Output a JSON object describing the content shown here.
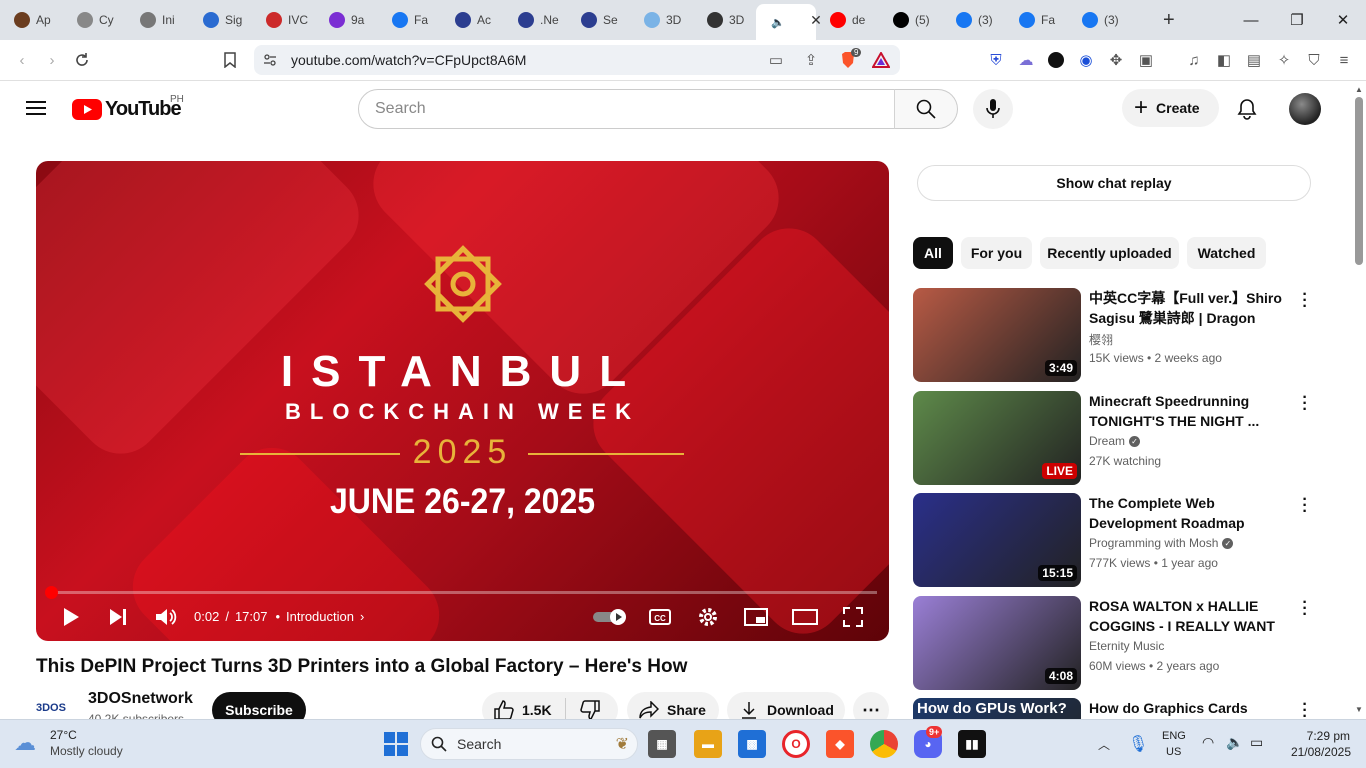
{
  "browser": {
    "tabs": [
      {
        "label": "Ap",
        "color": "#6b3d1f"
      },
      {
        "label": "Cy",
        "color": "#888888"
      },
      {
        "label": "Ini",
        "color": "#777777"
      },
      {
        "label": "Sig",
        "color": "#2a6bd1"
      },
      {
        "label": "IVC",
        "color": "#cc2a2a"
      },
      {
        "label": "9a",
        "color": "#7b2ed3"
      },
      {
        "label": "Fa",
        "color": "#1877f2"
      },
      {
        "label": "Ac",
        "color": "#2c3e90"
      },
      {
        "label": ".Ne",
        "color": "#2c3e90"
      },
      {
        "label": "Se",
        "color": "#2c3e90"
      },
      {
        "label": "3D",
        "color": "#7ab3e6"
      },
      {
        "label": "3D",
        "color": "#333333"
      },
      {
        "label": "",
        "color": "#ffffff"
      },
      {
        "label": "de",
        "color": "#ff0000"
      },
      {
        "label": "(5)",
        "color": "#000000"
      },
      {
        "label": "(3)",
        "color": "#1877f2"
      },
      {
        "label": "Fa",
        "color": "#1877f2"
      },
      {
        "label": "(3)",
        "color": "#1877f2"
      }
    ],
    "url": "youtube.com/watch?v=CFpUpct8A6M",
    "brave_badge": "9"
  },
  "youtube": {
    "logo_text": "YouTube",
    "region": "PH",
    "search_placeholder": "Search",
    "create_label": "Create"
  },
  "video": {
    "time_current": "0:02",
    "time_separator": "/",
    "time_total": "17:07",
    "chapter": "Introduction",
    "progress_fraction": 0.005,
    "title": "This DePIN Project Turns 3D Printers into a Global Factory – Here's How",
    "overlay": {
      "line1": "ISTANBUL",
      "line2": "BLOCKCHAIN WEEK",
      "year": "2025",
      "dates": "JUNE 26-27, 2025"
    },
    "channel": {
      "logo_text": "3DOS",
      "name": "3DOSnetwork",
      "subscribers": "40.2K subscribers"
    },
    "subscribe_label": "Subscribe",
    "likes": "1.5K",
    "share_label": "Share",
    "download_label": "Download"
  },
  "sidebar": {
    "chat_replay": "Show chat replay",
    "chips": [
      "All",
      "For you",
      "Recently uploaded",
      "Watched"
    ],
    "recommendations": [
      {
        "title": "中英CC字幕【Full ver.】Shiro Sagisu 鷺巣詩郎 | Dragon Raja...",
        "channel": "樱翎",
        "verified": false,
        "meta": "15K views • 2 weeks ago",
        "badge": "3:49",
        "live": false,
        "thumb_color": "#b85a45"
      },
      {
        "title": "Minecraft Speedrunning TONIGHT'S THE NIGHT ...",
        "channel": "Dream",
        "verified": true,
        "meta": "27K watching",
        "badge": "LIVE",
        "live": true,
        "thumb_color": "#5e8a4a"
      },
      {
        "title": "The Complete Web Development Roadmap",
        "channel": "Programming with Mosh",
        "verified": true,
        "meta": "777K views • 1 year ago",
        "badge": "15:15",
        "live": false,
        "thumb_color": "#2a2f8a"
      },
      {
        "title": "ROSA WALTON x HALLIE COGGINS - I REALLY WANT TO...",
        "channel": "Eternity Music",
        "verified": false,
        "meta": "60M views • 2 years ago",
        "badge": "4:08",
        "live": false,
        "thumb_color": "#9a7fd6"
      },
      {
        "title": "How do Graphics Cards Work?",
        "channel": "",
        "verified": false,
        "meta": "",
        "badge": "",
        "live": false,
        "thumb_color": "#1d3a6b",
        "thumb_text": "How do GPUs Work?"
      }
    ]
  },
  "taskbar": {
    "weather_temp": "27°C",
    "weather_desc": "Mostly cloudy",
    "search_label": "Search",
    "discord_badge": "9+",
    "lang_top": "ENG",
    "lang_bottom": "US",
    "time": "7:29 pm",
    "date": "21/08/2025"
  }
}
